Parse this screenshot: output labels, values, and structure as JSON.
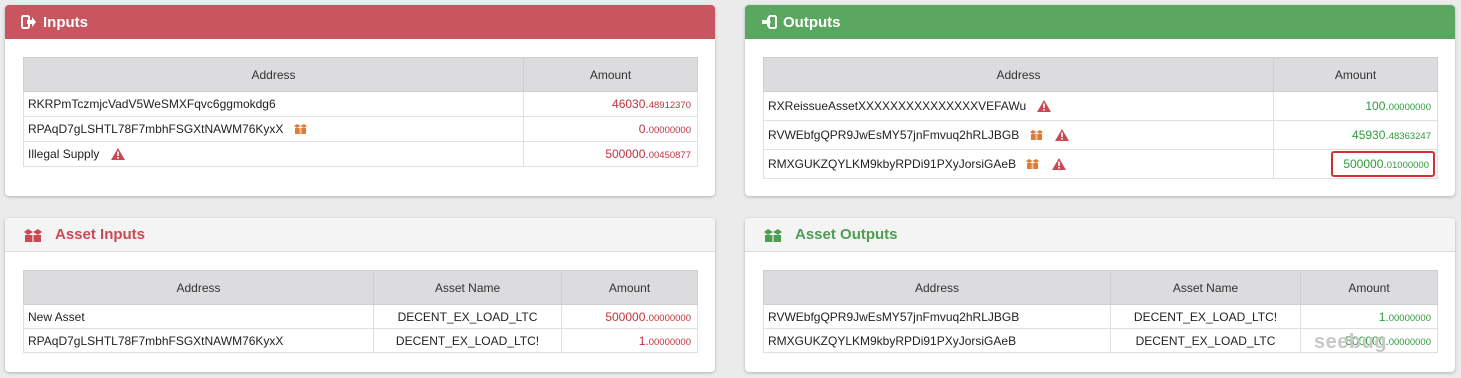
{
  "colors": {
    "input_header": "#c95560",
    "output_header": "#5aa85f",
    "negative_amount": "#c0323e",
    "positive_amount": "#2f9a3a",
    "highlight_box": "#d2312f"
  },
  "inputs": {
    "title": "Inputs",
    "icon": "sign-out-icon",
    "columns": {
      "address": "Address",
      "amount": "Amount"
    },
    "rows": [
      {
        "address": "RKRPmTczmjcVadV5WeSMXFqvc6ggmokdg6",
        "amount_int": "46030.",
        "amount_dec": "48912370"
      },
      {
        "address": "RPAqD7gLSHTL78F7mbhFSGXtNAWM76KyxX",
        "asset_icon": "box-icon",
        "amount_int": "0.",
        "amount_dec": "00000000"
      },
      {
        "address": "Illegal Supply",
        "warning_icon": "warning-icon",
        "amount_int": "500000.",
        "amount_dec": "00450877"
      }
    ]
  },
  "outputs": {
    "title": "Outputs",
    "icon": "sign-in-icon",
    "columns": {
      "address": "Address",
      "amount": "Amount"
    },
    "rows": [
      {
        "address": "RXReissueAssetXXXXXXXXXXXXXXXVEFAWu",
        "warning_icon": "warning-icon",
        "amount_int": "100.",
        "amount_dec": "00000000"
      },
      {
        "address": "RVWEbfgQPR9JwEsMY57jnFmvuq2hRLJBGB",
        "asset_icon": "box-icon",
        "warning_icon": "warning-icon",
        "amount_int": "45930.",
        "amount_dec": "48363247"
      },
      {
        "address": "RMXGUKZQYLKM9kbyRPDi91PXyJorsiGAeB",
        "asset_icon": "box-icon",
        "warning_icon": "warning-icon",
        "amount_int": "500000.",
        "amount_dec": "01000000",
        "highlighted": true
      }
    ]
  },
  "asset_inputs": {
    "title": "Asset Inputs",
    "icon": "boxes-icon",
    "columns": {
      "address": "Address",
      "asset_name": "Asset Name",
      "amount": "Amount"
    },
    "rows": [
      {
        "address": "New Asset",
        "asset_name": "DECENT_EX_LOAD_LTC",
        "amount_int": "500000.",
        "amount_dec": "00000000"
      },
      {
        "address": "RPAqD7gLSHTL78F7mbhFSGXtNAWM76KyxX",
        "asset_name": "DECENT_EX_LOAD_LTC!",
        "amount_int": "1.",
        "amount_dec": "00000000"
      }
    ]
  },
  "asset_outputs": {
    "title": "Asset Outputs",
    "icon": "boxes-icon",
    "columns": {
      "address": "Address",
      "asset_name": "Asset Name",
      "amount": "Amount"
    },
    "rows": [
      {
        "address": "RVWEbfgQPR9JwEsMY57jnFmvuq2hRLJBGB",
        "asset_name": "DECENT_EX_LOAD_LTC!",
        "amount_int": "1.",
        "amount_dec": "00000000"
      },
      {
        "address": "RMXGUKZQYLKM9kbyRPDi91PXyJorsiGAeB",
        "asset_name": "DECENT_EX_LOAD_LTC",
        "amount_int": "500000.",
        "amount_dec": "00000000"
      }
    ]
  },
  "watermark": {
    "text": "seebug"
  }
}
